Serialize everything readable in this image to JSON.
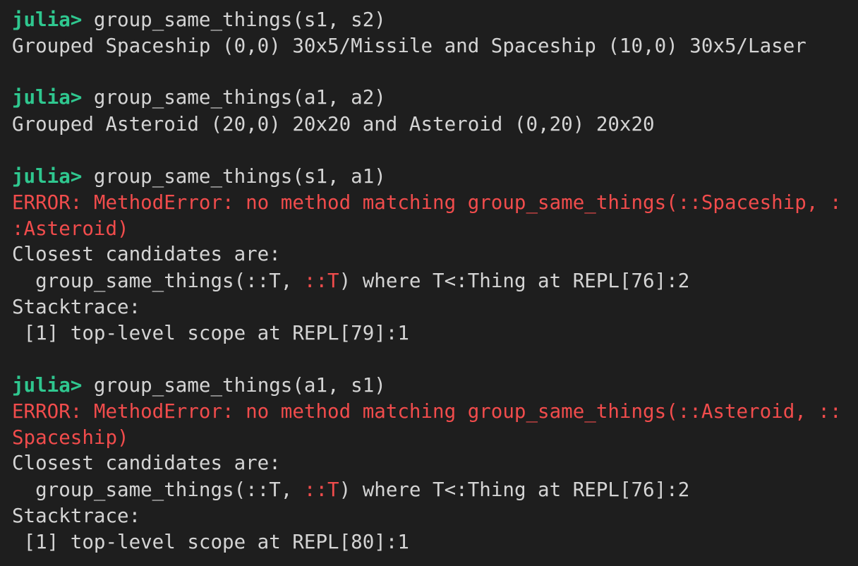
{
  "colors": {
    "background": "#1e1e1e",
    "text": "#d4d4d4",
    "prompt": "#2fc78f",
    "error": "#f14c4c"
  },
  "session": {
    "blocks": [
      {
        "prompt": "julia> ",
        "command": "group_same_things(s1, s2)",
        "output": "Grouped Spaceship (0,0) 30x5/Missile and Spaceship (10,0) 30x5/Laser"
      },
      {
        "prompt": "julia> ",
        "command": "group_same_things(a1, a2)",
        "output": "Grouped Asteroid (20,0) 20x20 and Asteroid (0,20) 20x20"
      },
      {
        "prompt": "julia> ",
        "command": "group_same_things(s1, a1)",
        "error_line1": "ERROR: MethodError: no method matching group_same_things(::Spaceship, :",
        "error_line2": ":Asteroid)",
        "closest": "Closest candidates are:",
        "candidate_a": "  group_same_things(::T, ",
        "candidate_b": "::T",
        "candidate_c": ") where T<:Thing at REPL[76]:2",
        "stacktrace": "Stacktrace:",
        "frame": " [1] top-level scope at REPL[79]:1"
      },
      {
        "prompt": "julia> ",
        "command": "group_same_things(a1, s1)",
        "error_line1": "ERROR: MethodError: no method matching group_same_things(::Asteroid, ::",
        "error_line2": "Spaceship)",
        "closest": "Closest candidates are:",
        "candidate_a": "  group_same_things(::T, ",
        "candidate_b": "::T",
        "candidate_c": ") where T<:Thing at REPL[76]:2",
        "stacktrace": "Stacktrace:",
        "frame": " [1] top-level scope at REPL[80]:1"
      }
    ]
  }
}
